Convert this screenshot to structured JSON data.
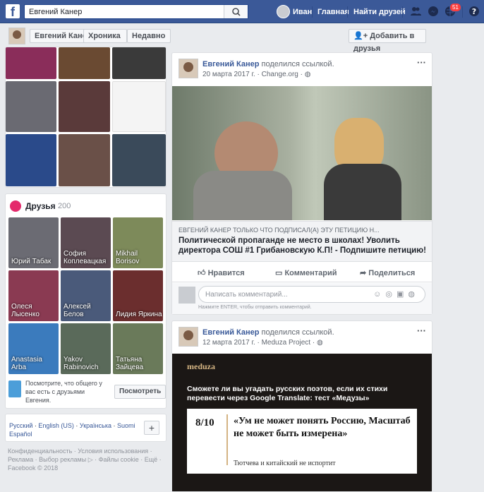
{
  "topbar": {
    "search_value": "Евгений Канер",
    "user": "Иван",
    "home": "Главная",
    "find_friends": "Найти друзей",
    "notif_count": "51"
  },
  "profile": {
    "name": "Евгений Канер",
    "timeline": "Хроника",
    "recent": "Недавно",
    "add_friend": "Добавить в друзья"
  },
  "friends": {
    "title": "Друзья",
    "count": "200",
    "tiles": [
      {
        "name": "Юрий Табак",
        "color": "#6b6b73"
      },
      {
        "name": "София Коплевацкая",
        "color": "#5b4a52"
      },
      {
        "name": "Mikhail Borisov",
        "color": "#7d8a5a"
      },
      {
        "name": "Олеся Лысенко",
        "color": "#8a3a52"
      },
      {
        "name": "Алексей Белов",
        "color": "#4a5a7a"
      },
      {
        "name": "Лидия Яркина",
        "color": "#6b2e2e"
      },
      {
        "name": "Anastasia Arba",
        "color": "#3b7bbd"
      },
      {
        "name": "Yakov Rabinovich",
        "color": "#5a6a5a"
      },
      {
        "name": "Татьяна Зайцева",
        "color": "#6a7a5a"
      }
    ],
    "prompt": "Посмотрите, что общего у вас есть с друзьями Евгения.",
    "prompt_btn": "Посмотреть"
  },
  "languages": {
    "items": [
      "Русский",
      "English (US)",
      "Українська",
      "Suomi",
      "Español"
    ]
  },
  "footer": {
    "line1": "Конфиденциальность · Условия использования ·",
    "line2": "Реклама · Выбор рекламы ▷ · Файлы cookie · Ещё ·",
    "line3": "Facebook © 2018"
  },
  "post1": {
    "author": "Евгений Канер",
    "action": "поделился ссылкой.",
    "meta": "20 марта 2017 г. · Change.org ·",
    "link_caption": "ЕВГЕНИЙ КАНЕР ТОЛЬКО ЧТО ПОДПИСАЛ(А) ЭТУ ПЕТИЦИЮ Н...",
    "link_title": "Политической пропаганде не место в школах! Уволить директора СОШ #1 Грибановскую К.П! - Подпишите петицию!",
    "like": "Нравится",
    "comment": "Комментарий",
    "share": "Поделиться",
    "comment_placeholder": "Написать комментарий...",
    "comment_hint": "Нажмите ENTER, чтобы отправить комментарий."
  },
  "post2": {
    "author": "Евгений Канер",
    "action": "поделился ссылкой.",
    "meta": "12 марта 2017 г. · Meduza Project ·",
    "brand": "meduza",
    "headline": "Сможете ли вы угадать русских поэтов, если их стихи перевести через Google Translate: тест «Медузы»",
    "score": "8/10",
    "quote": "«Ум не может понять Россию, Масштаб не может быть измерена»",
    "sub": "Тютчева и китайский не испортит"
  }
}
